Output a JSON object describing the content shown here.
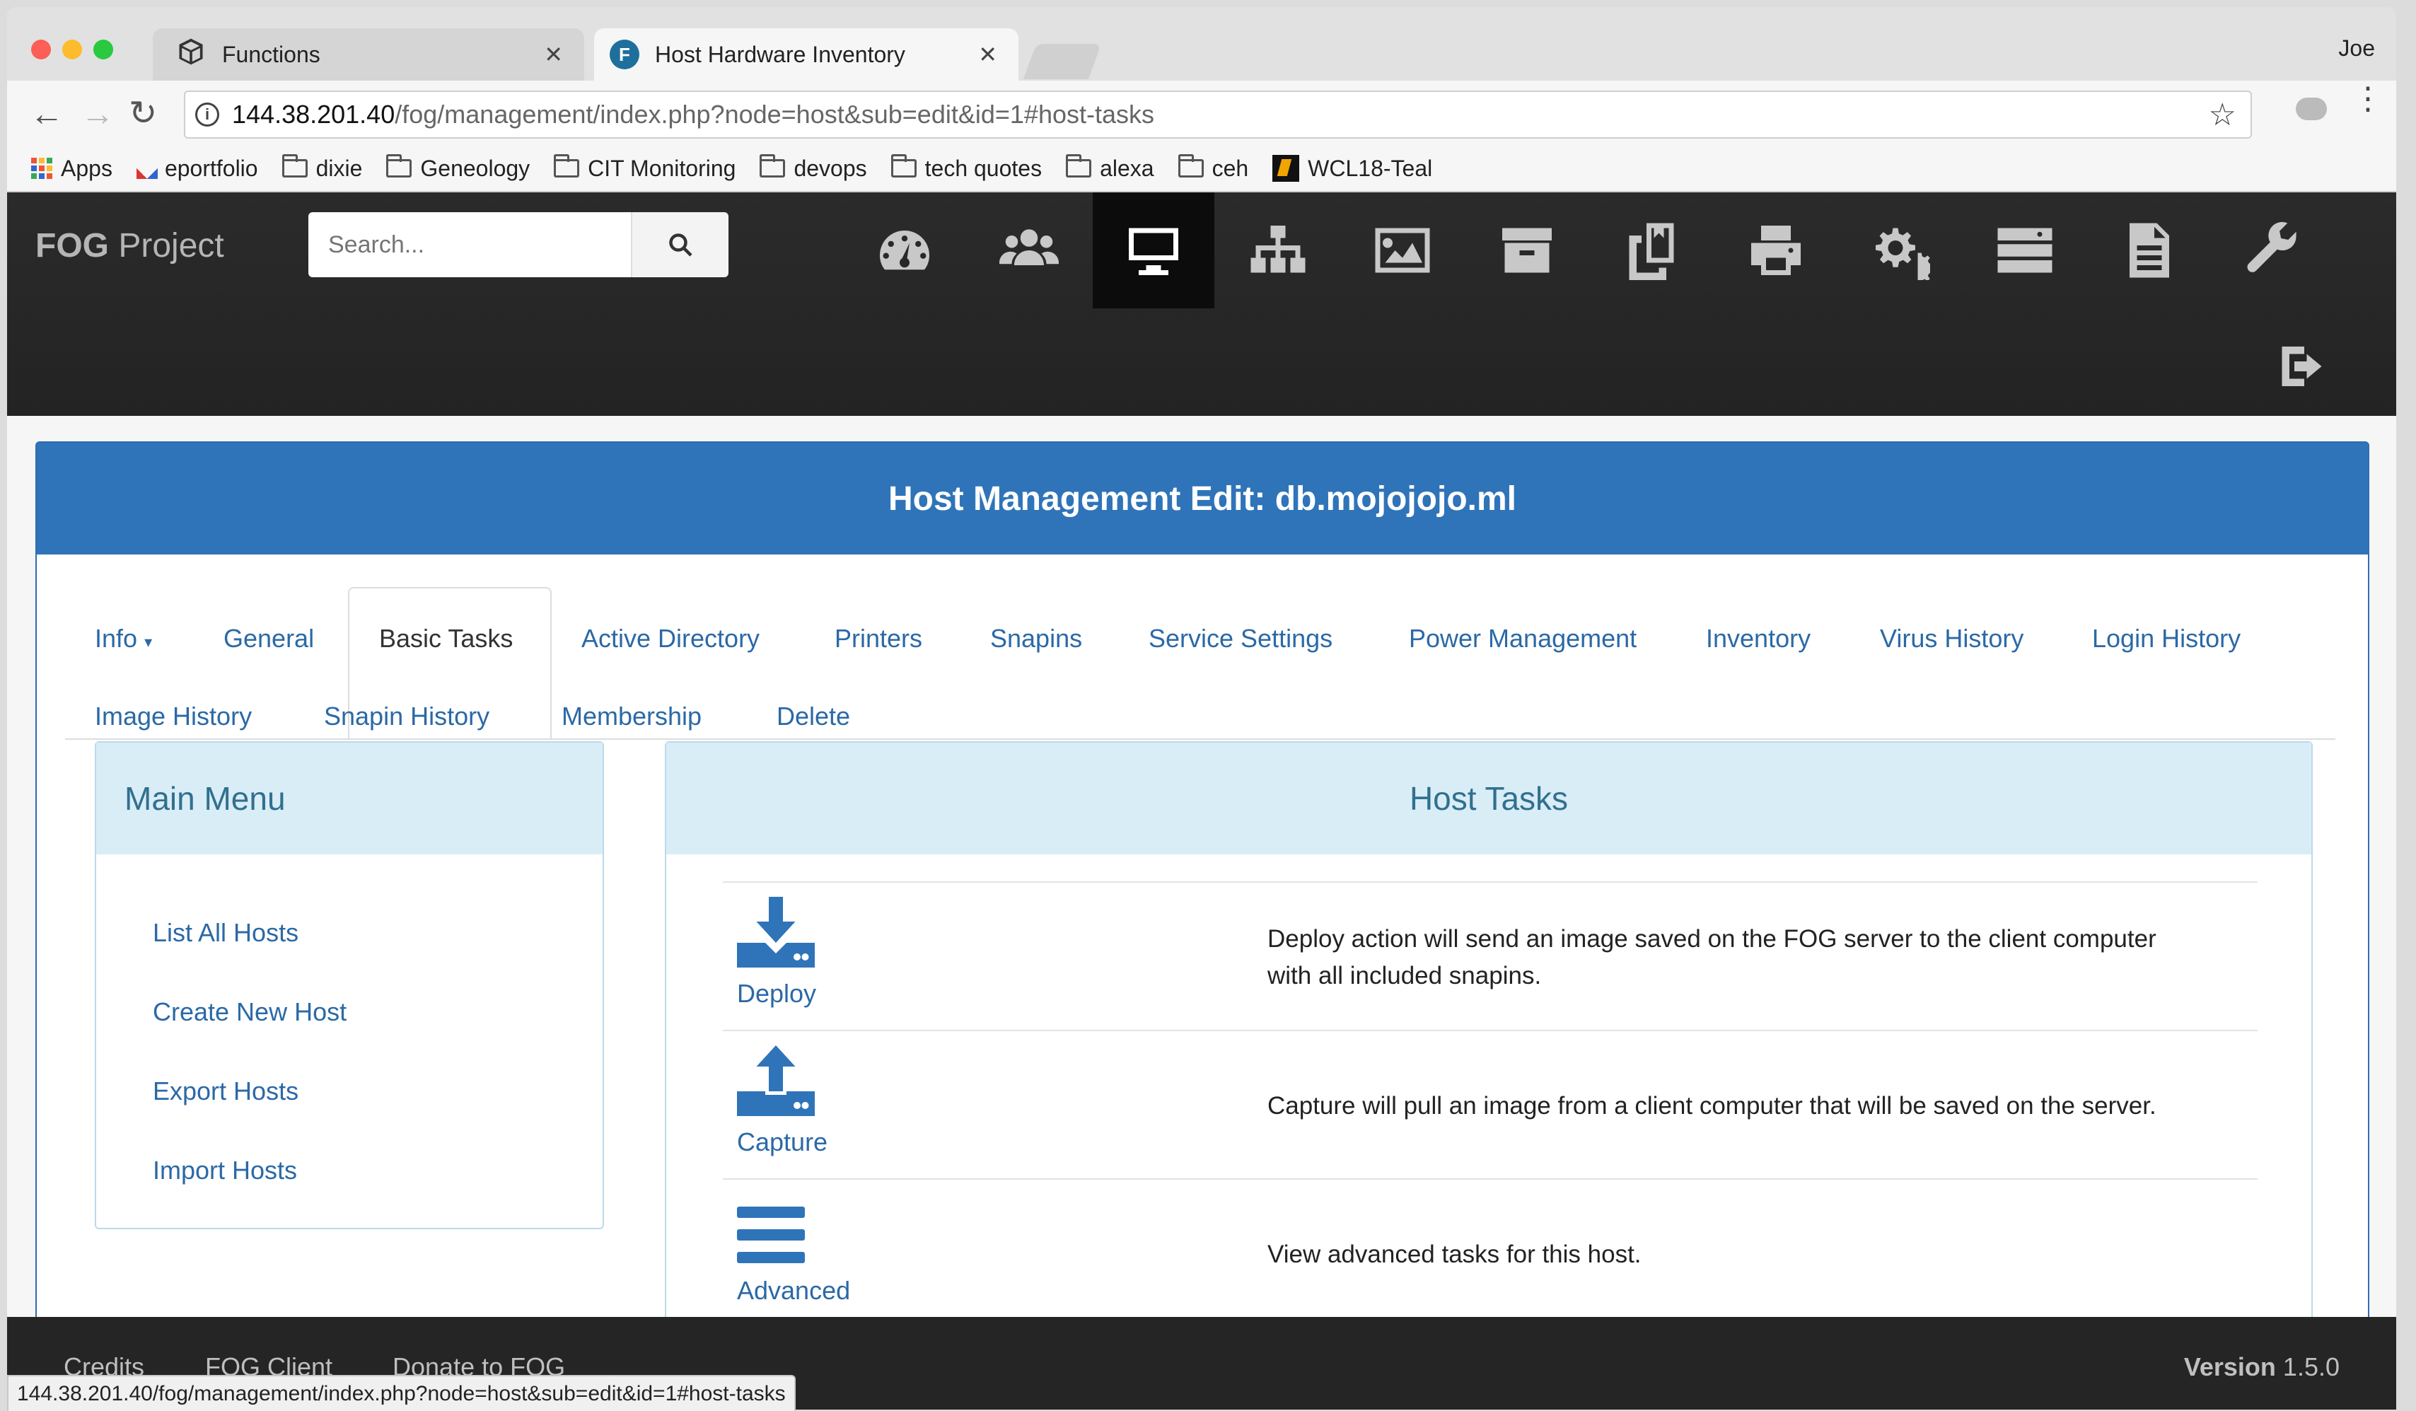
{
  "browser": {
    "tabs": [
      {
        "label": "Functions",
        "active": false
      },
      {
        "label": "Host Hardware Inventory",
        "active": true
      }
    ],
    "profile_name": "Joe",
    "url_host": "144.38.201.40",
    "url_path": "/fog/management/index.php?node=host&sub=edit&id=1#host-tasks",
    "bookmarks": [
      "Apps",
      "eportfolio",
      "dixie",
      "Geneology",
      "CIT Monitoring",
      "devops",
      "tech quotes",
      "alexa",
      "ceh",
      "WCL18-Teal"
    ],
    "status_url": "144.38.201.40/fog/management/index.php?node=host&sub=edit&id=1#host-tasks"
  },
  "fog": {
    "brand_bold": "FOG",
    "brand_rest": " Project",
    "search_placeholder": "Search...",
    "nav_icons": [
      "dashboard-icon",
      "users-icon",
      "hosts-icon",
      "groups-icon",
      "images-icon",
      "storage-icon",
      "snapins-icon",
      "printers-icon",
      "services-icon",
      "tasks-icon",
      "reports-icon",
      "settings-icon"
    ],
    "active_nav": "hosts-icon"
  },
  "page": {
    "title": "Host Management Edit: db.mojojojo.ml",
    "tabs_row1": [
      "Info",
      "General",
      "Basic Tasks",
      "Active Directory",
      "Printers",
      "Snapins",
      "Service Settings",
      "Power Management",
      "Inventory",
      "Virus History",
      "Login History"
    ],
    "tabs_row2": [
      "Image History",
      "Snapin History",
      "Membership",
      "Delete"
    ],
    "active_tab": "Basic Tasks",
    "main_menu": {
      "title": "Main Menu",
      "items": [
        "List All Hosts",
        "Create New Host",
        "Export Hosts",
        "Import Hosts"
      ]
    },
    "host_tasks": {
      "title": "Host Tasks",
      "rows": [
        {
          "label": "Deploy",
          "desc_line1": "Deploy action will send an image saved on the FOG server to the client computer",
          "desc_line2": "with all included snapins."
        },
        {
          "label": "Capture",
          "desc_line1": "Capture will pull an image from a client computer that will be saved on the server.",
          "desc_line2": ""
        },
        {
          "label": "Advanced",
          "desc_line1": "View advanced tasks for this host.",
          "desc_line2": ""
        }
      ]
    }
  },
  "footer": {
    "links": [
      "Credits",
      "FOG Client",
      "Donate to FOG"
    ],
    "version_label": "Version",
    "version_value": "1.5.0"
  },
  "colors": {
    "header_blue": "#2f74b9",
    "link_blue": "#2b69a6",
    "subhead_bg": "#d9edf7",
    "dark_bar": "#252525"
  }
}
